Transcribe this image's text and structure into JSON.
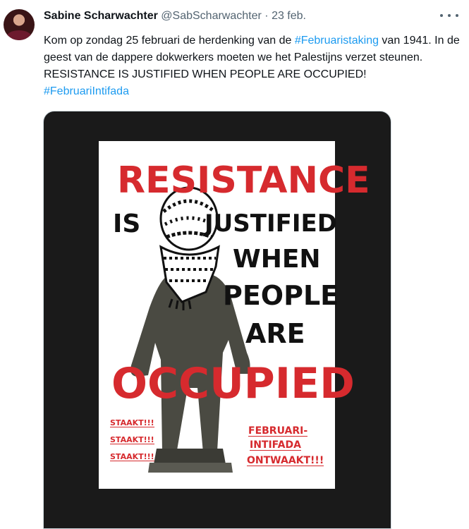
{
  "tweet": {
    "author_name": "Sabine Scharwachter",
    "author_handle": "@SabScharwachter",
    "separator": "·",
    "date": "23 feb.",
    "text_parts": {
      "line1_a": "Kom op zondag 25 februari de herdenking van de ",
      "hashtag1": "#Februaristaking",
      "line1_b": " van 1941. In de geest van de dappere dokwerkers moeten we het Palestijns verzet steunen. RESISTANCE IS JUSTIFIED WHEN PEOPLE ARE OCCUPIED!",
      "hashtag2": "#FebruariIntifada"
    }
  },
  "poster": {
    "resistance": "RESISTANCE",
    "is": "IS",
    "justified": "JUSTIFIED",
    "when": "WHEN",
    "people": "PEOPLE",
    "are": "ARE",
    "occupied": "OCCUPIED",
    "staakt": [
      "STAAKT!!!",
      "STAAKT!!!",
      "STAAKT!!!"
    ],
    "februari": "FEBRUARI-",
    "intifada": "INTIFADA",
    "ontwaakt": "ONTWAAKT!!!"
  },
  "colors": {
    "poster_red": "#d62a2e",
    "hashtag_blue": "#1d9bf0",
    "statue_bronze": "#4a4a42",
    "keffiyeh": "#111111"
  },
  "icons": [
    "more-icon"
  ]
}
